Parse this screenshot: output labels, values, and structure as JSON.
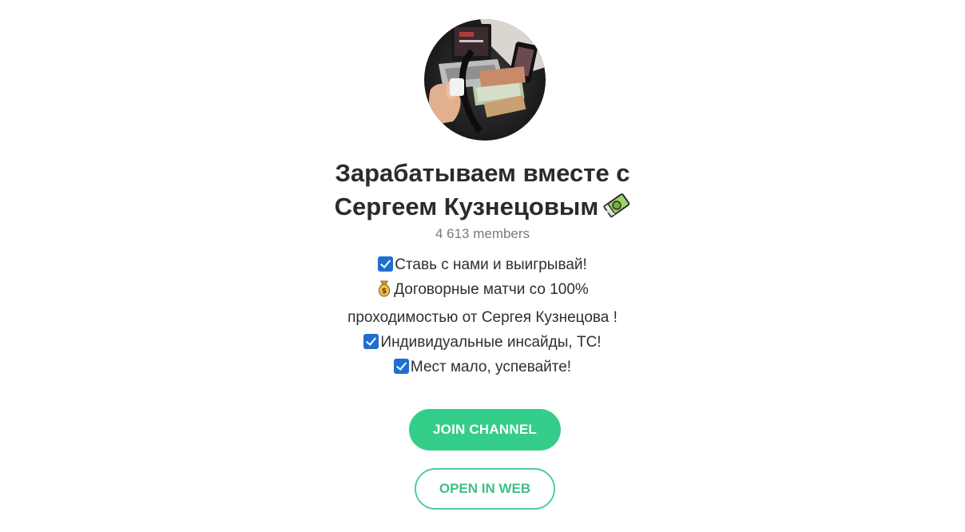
{
  "channel": {
    "title_line1": "Зарабатываем вместе с",
    "title_line2": "Сергеем Кузнецовым",
    "title_emoji_icon": "money-with-wings-icon",
    "members": "4 613 members",
    "avatar_icon": "channel-avatar-photo"
  },
  "description": {
    "line1": "Ставь с нами и выигрывай!",
    "line2": "Договорные матчи со 100%",
    "line3": "проходимостью от Сергея Кузнецова !",
    "line4": "Индивидуальные инсайды, ТС!",
    "line5": "Мест мало, успевайте!",
    "check_icon": "check-mark-button-icon",
    "bag_icon": "money-bag-icon"
  },
  "buttons": {
    "join_label": "JOIN CHANNEL",
    "web_label": "OPEN IN WEB"
  },
  "colors": {
    "accent_green": "#35cd8a",
    "outline_green": "#4fcf96",
    "check_blue": "#1f6fd1",
    "title_text": "#2b2b2b",
    "muted_text": "#7a7a7a"
  }
}
